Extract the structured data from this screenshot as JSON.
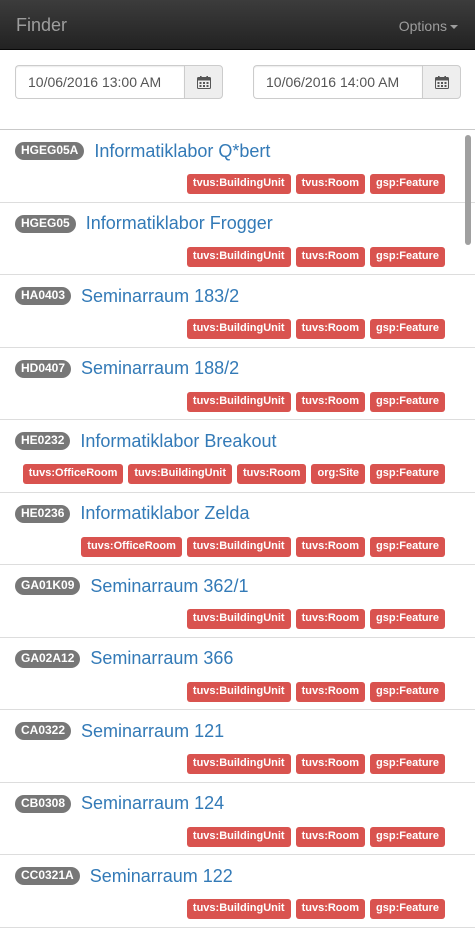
{
  "navbar": {
    "brand": "Finder",
    "options_label": "Options"
  },
  "date_range": {
    "start": "10/06/2016 13:00 AM",
    "end": "10/06/2016 14:00 AM"
  },
  "icons": {
    "calendar": "calendar-icon",
    "caret": "caret-down-icon"
  },
  "colors": {
    "navbar": "#222222",
    "badge": "#777777",
    "tag": "#d9534f",
    "link": "#337ab7"
  },
  "items": [
    {
      "code": "HGEG05A",
      "name": "Informatiklabor Q*bert",
      "tags": [
        "tvus:BuildingUnit",
        "tvus:Room",
        "gsp:Feature"
      ]
    },
    {
      "code": "HGEG05",
      "name": "Informatiklabor Frogger",
      "tags": [
        "tuvs:BuildingUnit",
        "tuvs:Room",
        "gsp:Feature"
      ]
    },
    {
      "code": "HA0403",
      "name": "Seminarraum 183/2",
      "tags": [
        "tuvs:BuildingUnit",
        "tuvs:Room",
        "gsp:Feature"
      ]
    },
    {
      "code": "HD0407",
      "name": "Seminarraum 188/2",
      "tags": [
        "tuvs:BuildingUnit",
        "tuvs:Room",
        "gsp:Feature"
      ]
    },
    {
      "code": "HE0232",
      "name": "Informatiklabor Breakout",
      "tags": [
        "tuvs:OfficeRoom",
        "tuvs:BuildingUnit",
        "tuvs:Room",
        "org:Site",
        "gsp:Feature"
      ]
    },
    {
      "code": "HE0236",
      "name": "Informatiklabor Zelda",
      "tags": [
        "tuvs:OfficeRoom",
        "tuvs:BuildingUnit",
        "tuvs:Room",
        "gsp:Feature"
      ]
    },
    {
      "code": "GA01K09",
      "name": "Seminarraum 362/1",
      "tags": [
        "tuvs:BuildingUnit",
        "tuvs:Room",
        "gsp:Feature"
      ]
    },
    {
      "code": "GA02A12",
      "name": "Seminarraum 366",
      "tags": [
        "tuvs:BuildingUnit",
        "tuvs:Room",
        "gsp:Feature"
      ]
    },
    {
      "code": "CA0322",
      "name": "Seminarraum 121",
      "tags": [
        "tuvs:BuildingUnit",
        "tuvs:Room",
        "gsp:Feature"
      ]
    },
    {
      "code": "CB0308",
      "name": "Seminarraum 124",
      "tags": [
        "tuvs:BuildingUnit",
        "tuvs:Room",
        "gsp:Feature"
      ]
    },
    {
      "code": "CC0321A",
      "name": "Seminarraum 122",
      "tags": [
        "tuvs:BuildingUnit",
        "tuvs:Room",
        "gsp:Feature"
      ]
    }
  ]
}
